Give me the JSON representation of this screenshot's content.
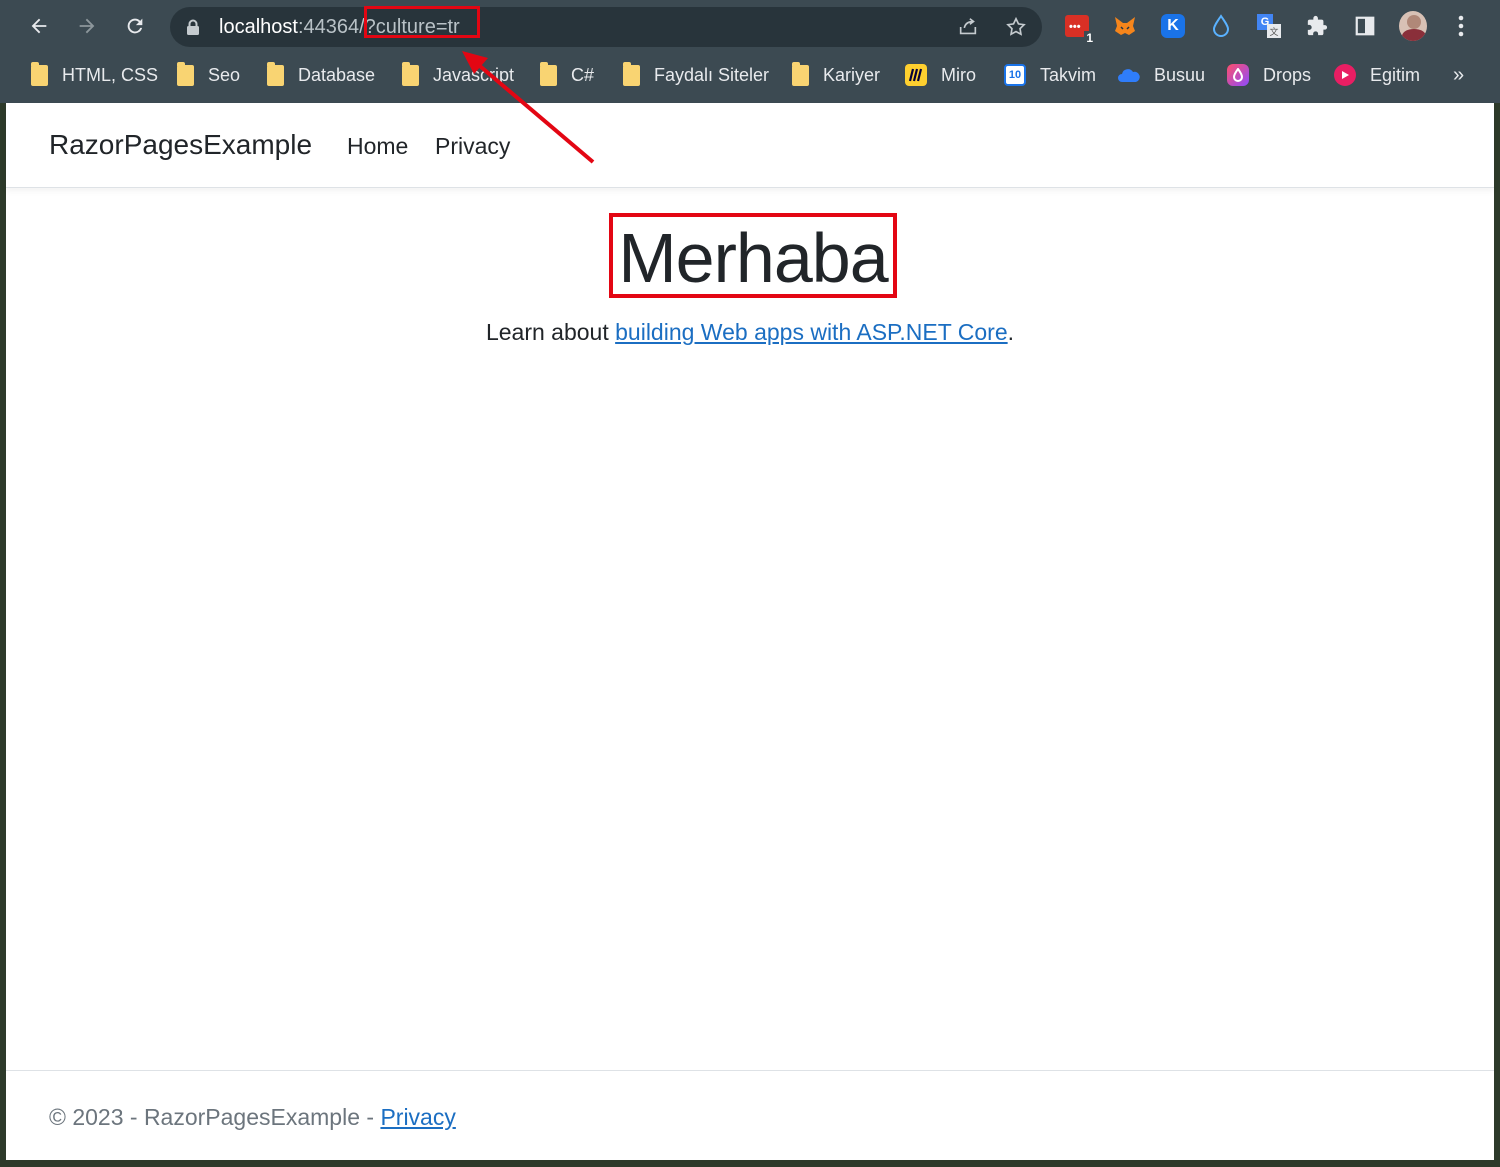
{
  "browser": {
    "url": {
      "host": "localhost",
      "port": ":44364",
      "query": "/?culture=tr"
    },
    "extensions": {
      "badge_count": "1"
    },
    "bookmarks": [
      {
        "label": "HTML, CSS",
        "icon": "folder-icon"
      },
      {
        "label": "Seo",
        "icon": "folder-icon"
      },
      {
        "label": "Database",
        "icon": "folder-icon"
      },
      {
        "label": "Javascript",
        "icon": "folder-icon"
      },
      {
        "label": "C#",
        "icon": "folder-icon"
      },
      {
        "label": "Faydalı Siteler",
        "icon": "folder-icon"
      },
      {
        "label": "Kariyer",
        "icon": "folder-icon"
      },
      {
        "label": "Miro",
        "icon": "miro-icon"
      },
      {
        "label": "Takvim",
        "icon": "calendar-icon",
        "icon_text": "10"
      },
      {
        "label": "Busuu",
        "icon": "busuu-icon"
      },
      {
        "label": "Drops",
        "icon": "drops-icon"
      },
      {
        "label": "Egitim",
        "icon": "egitim-icon"
      }
    ],
    "overflow": "»"
  },
  "app": {
    "brand": "RazorPagesExample",
    "nav": [
      {
        "label": "Home"
      },
      {
        "label": "Privacy"
      }
    ],
    "hero": {
      "title": "Merhaba",
      "lead_prefix": "Learn about ",
      "lead_link": "building Web apps with ASP.NET Core",
      "lead_suffix": "."
    },
    "footer": {
      "prefix": "© 2023 - RazorPagesExample - ",
      "link": "Privacy"
    }
  },
  "colors": {
    "annotation": "#e30613",
    "link": "#1b6ec2",
    "chrome": "#3c4a52"
  }
}
